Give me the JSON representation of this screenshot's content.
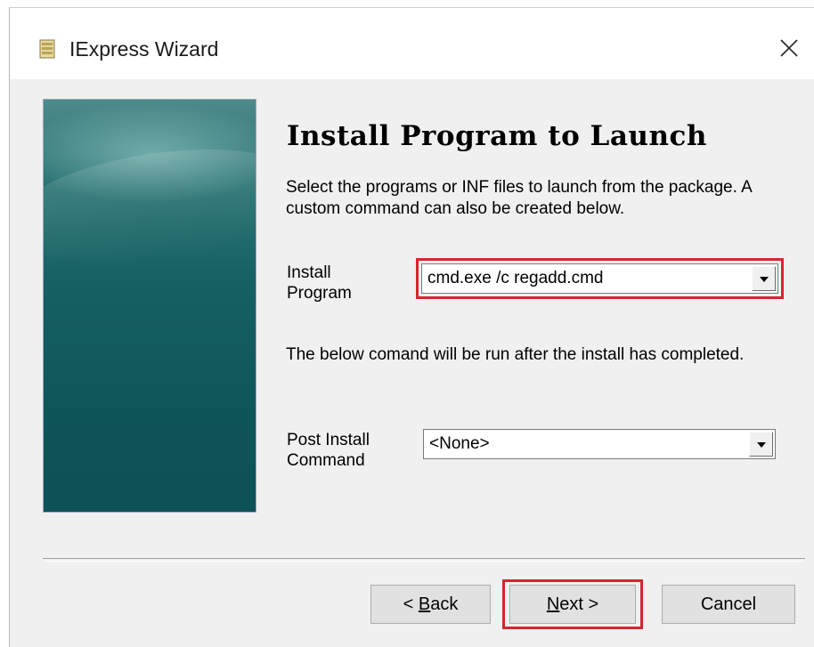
{
  "window": {
    "title": "IExpress Wizard",
    "close_label": "×"
  },
  "icons": {
    "app": "iexpress-app-icon",
    "close": "close-icon",
    "dropdown": "chevron-down-icon"
  },
  "page": {
    "heading": "Install Program to Launch",
    "description": "Select the programs or INF files to launch from the package.  A custom command can also be created below.",
    "install_program": {
      "label_line1": "Install",
      "label_line2": "Program",
      "value": "cmd.exe /c regadd.cmd"
    },
    "post_note": "The below comand will be run after the install has completed.",
    "post_install": {
      "label_line1": "Post Install",
      "label_line2": "Command",
      "value": "<None>"
    }
  },
  "buttons": {
    "back_prefix": "< ",
    "back_key": "B",
    "back_rest": "ack",
    "next_key": "N",
    "next_rest": "ext >",
    "cancel": "Cancel"
  },
  "colors": {
    "highlight": "#d9252f",
    "banner": "#166062"
  }
}
